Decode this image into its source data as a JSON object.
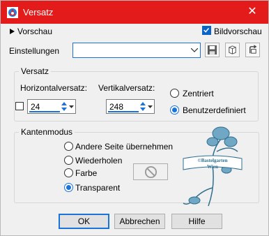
{
  "window": {
    "title": "Versatz",
    "close_glyph": "✕"
  },
  "toolbar": {
    "preview_toggle_label": "Vorschau",
    "bildvorschau_label": "Bildvorschau",
    "bildvorschau_checked": true,
    "settings_label": "Einstellungen",
    "settings_value": "",
    "icons": [
      "save-icon",
      "delete-icon",
      "reset-icon"
    ]
  },
  "offset_group": {
    "title": "Versatz",
    "horizontal_label": "Horizontalversatz:",
    "horizontal_value": "24",
    "vertical_label": "Vertikalversatz:",
    "vertical_value": "248",
    "link_checkbox_checked": false,
    "options": [
      {
        "label": "Zentriert",
        "checked": false
      },
      {
        "label": "Benutzerdefiniert",
        "checked": true
      }
    ]
  },
  "edge_group": {
    "title": "Kantenmodus",
    "options": [
      {
        "label": "Andere Seite übernehmen",
        "checked": false
      },
      {
        "label": "Wiederholen",
        "checked": false
      },
      {
        "label": "Farbe",
        "checked": false
      },
      {
        "label": "Transparent",
        "checked": true
      }
    ],
    "color_swatch_icon": "no-color-icon"
  },
  "watermark": {
    "line1": "©Bastelgarten",
    "line2": "Wien"
  },
  "buttons": {
    "ok": "OK",
    "cancel": "Abbrechen",
    "help": "Hilfe"
  },
  "colors": {
    "titlebar": "#e41b1b",
    "accent": "#1a73d9",
    "watermark": "#2f6f8f"
  }
}
